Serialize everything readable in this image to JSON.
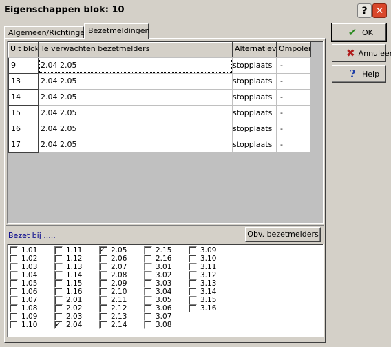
{
  "window": {
    "title": "Eigenschappen blok: 10"
  },
  "title_buttons": {
    "help": "?",
    "close": "✕"
  },
  "tabs": [
    {
      "label": "Algemeen/Richtingen",
      "active": false
    },
    {
      "label": "Bezetmeldingen",
      "active": true
    }
  ],
  "grid": {
    "headers": [
      "Uit blok",
      "Te verwachten bezetmelders",
      "Alternatieve",
      "Ompolen"
    ],
    "rows": [
      {
        "uit_blok": "9",
        "melders": "2.04  2.05",
        "alternatieve": "stopplaats",
        "ompolen": "-"
      },
      {
        "uit_blok": "13",
        "melders": "2.04  2.05",
        "alternatieve": "stopplaats",
        "ompolen": "-"
      },
      {
        "uit_blok": "14",
        "melders": "2.04  2.05",
        "alternatieve": "stopplaats",
        "ompolen": "-"
      },
      {
        "uit_blok": "15",
        "melders": "2.04  2.05",
        "alternatieve": "stopplaats",
        "ompolen": "-"
      },
      {
        "uit_blok": "16",
        "melders": "2.04  2.05",
        "alternatieve": "stopplaats",
        "ompolen": "-"
      },
      {
        "uit_blok": "17",
        "melders": "2.04  2.05",
        "alternatieve": "stopplaats",
        "ompolen": "-"
      }
    ]
  },
  "bezet": {
    "label": "Bezet bij .....",
    "obv_button": "Obv. bezetmelders",
    "columns": [
      [
        "1.01",
        "1.02",
        "1.03",
        "1.04",
        "1.05",
        "1.06",
        "1.07",
        "1.08",
        "1.09",
        "1.10"
      ],
      [
        "1.11",
        "1.12",
        "1.13",
        "1.14",
        "1.15",
        "1.16",
        "2.01",
        "2.02",
        "2.03",
        "2.04"
      ],
      [
        "2.05",
        "2.06",
        "2.07",
        "2.08",
        "2.09",
        "2.10",
        "2.11",
        "2.12",
        "2.13",
        "2.14"
      ],
      [
        "2.15",
        "2.16",
        "3.01",
        "3.02",
        "3.03",
        "3.04",
        "3.05",
        "3.06",
        "3.07",
        "3.08"
      ],
      [
        "3.09",
        "3.10",
        "3.11",
        "3.12",
        "3.13",
        "3.14",
        "3.15",
        "3.16"
      ]
    ],
    "checked": [
      "2.04",
      "2.05"
    ]
  },
  "buttons": {
    "ok": "OK",
    "cancel": "Annuleer",
    "help": "Help"
  },
  "icons": {
    "ok": "check-icon",
    "cancel": "x-icon",
    "help": "question-icon"
  },
  "colors": {
    "window_bg": "#d4d0c8",
    "bezet_label": "#00008b",
    "close_button": "#d9472b"
  }
}
